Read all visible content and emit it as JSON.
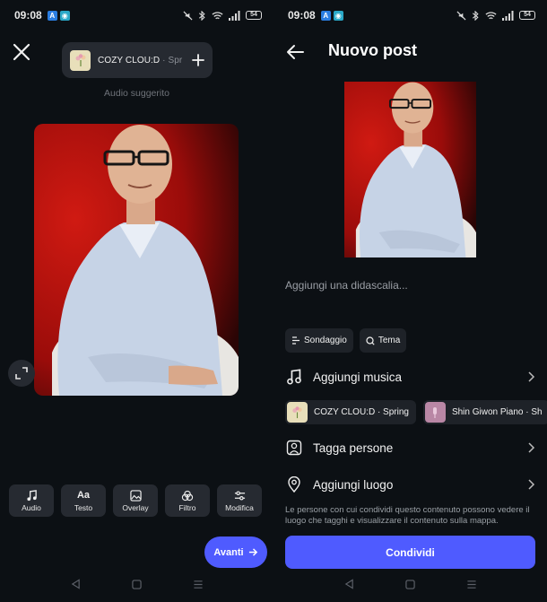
{
  "status": {
    "time": "09:08",
    "battery": "54"
  },
  "left": {
    "audio_title": "COZY CLOU:D",
    "audio_sub": " · Spr",
    "audio_suggested": "Audio suggerito",
    "tools": [
      {
        "label": "Audio",
        "icon": "music-note-icon"
      },
      {
        "label": "Testo",
        "icon": "text-aa-icon"
      },
      {
        "label": "Overlay",
        "icon": "overlay-image-icon"
      },
      {
        "label": "Filtro",
        "icon": "filter-circles-icon"
      },
      {
        "label": "Modifica",
        "icon": "sliders-icon"
      }
    ],
    "next_label": "Avanti"
  },
  "right": {
    "title": "Nuovo post",
    "caption_placeholder": "Aggiungi una didascalia...",
    "chips": {
      "poll": "Sondaggio",
      "topic": "Tema"
    },
    "add_music": "Aggiungi musica",
    "music_suggestions": [
      {
        "title": "COZY CLOU:D · Spring"
      },
      {
        "title": "Shin Giwon Piano · Sh"
      }
    ],
    "tag_people": "Tagga persone",
    "add_location": "Aggiungi luogo",
    "disclaimer": "Le persone con cui condividi questo contenuto possono vedere il luogo che tagghi e visualizzare il contenuto sulla mappa.",
    "share_label": "Condividi"
  },
  "colors": {
    "bg": "#0c1014",
    "surface": "#262a31",
    "accent": "#4f5bff",
    "photo_bg": "#c0120e"
  }
}
